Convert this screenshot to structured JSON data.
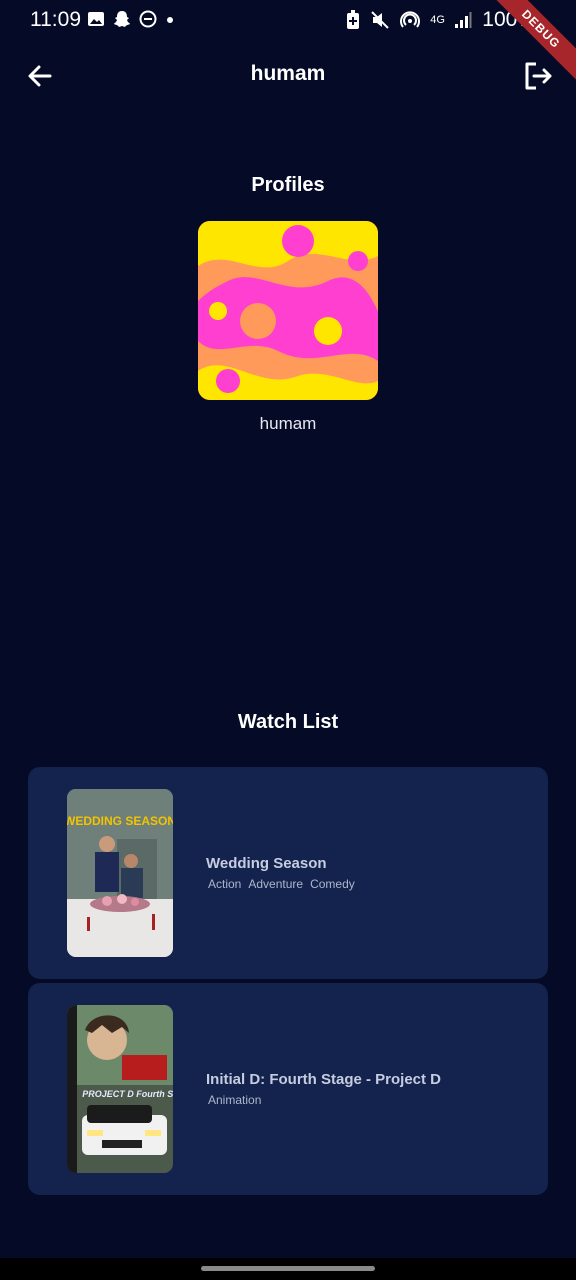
{
  "status_bar": {
    "time": "11:09",
    "network": "4G",
    "battery": "100%",
    "debug_banner": "DEBUG"
  },
  "app_bar": {
    "title": "humam"
  },
  "profiles": {
    "heading": "Profiles",
    "items": [
      {
        "name": "humam"
      }
    ]
  },
  "watch_list": {
    "heading": "Watch List",
    "items": [
      {
        "title": "Wedding Season",
        "genres": [
          "Action",
          "Adventure",
          "Comedy"
        ],
        "poster_text": "WEDDING SEASON"
      },
      {
        "title": "Initial D: Fourth Stage - Project D",
        "genres": [
          "Animation"
        ],
        "poster_text": "PROJECT D Fourth Stage"
      }
    ]
  },
  "colors": {
    "background": "#050b26",
    "card": "#13234d",
    "profile_yellow": "#ffe600",
    "profile_pink": "#ff3fd0"
  }
}
